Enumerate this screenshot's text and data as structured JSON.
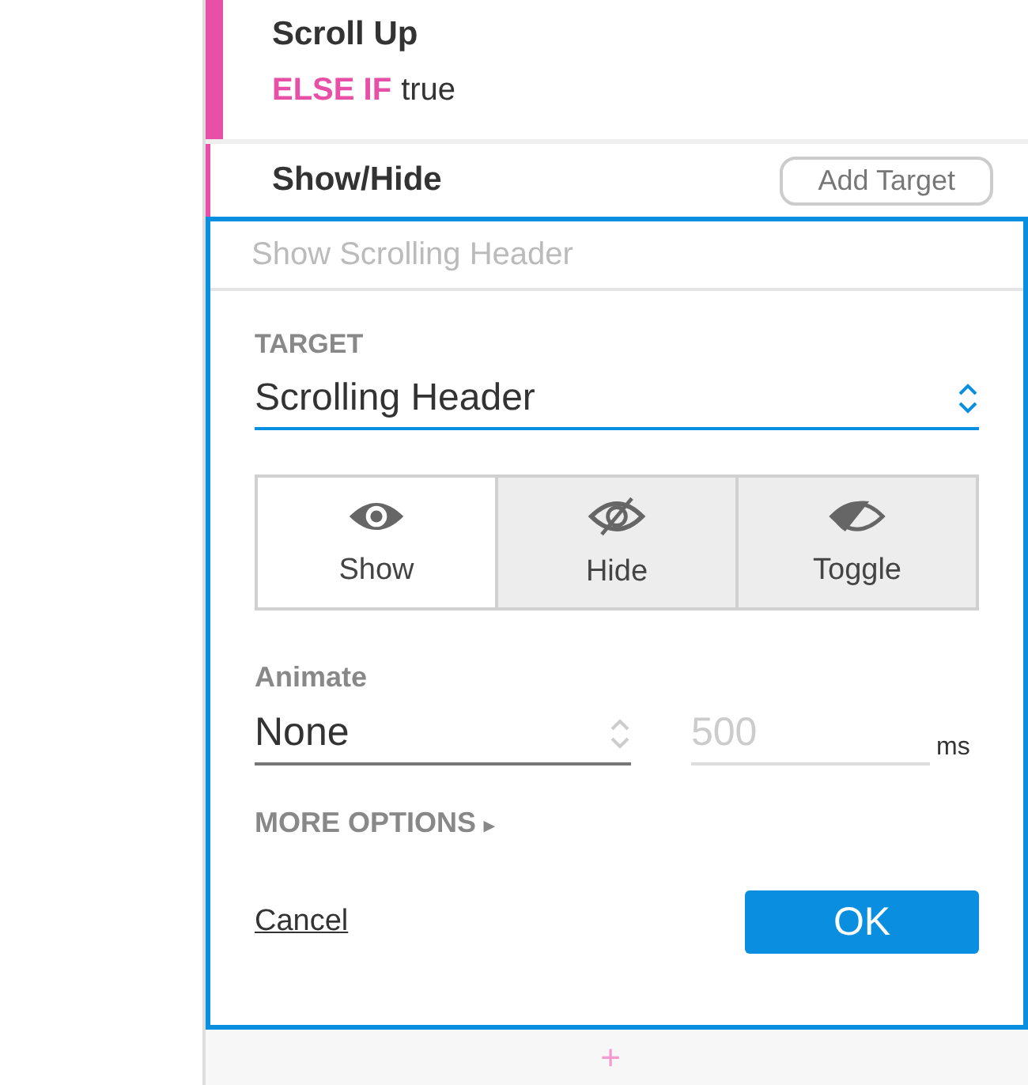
{
  "event": {
    "title": "Scroll Up",
    "condition_keyword": "ELSE IF",
    "condition_value": "true"
  },
  "action": {
    "title": "Show/Hide",
    "add_button": "Add Target"
  },
  "editor": {
    "name_placeholder": "Show Scrolling Header",
    "target_label": "TARGET",
    "target_value": "Scrolling Header",
    "modes": [
      {
        "label": "Show",
        "kind": "show",
        "selected": true
      },
      {
        "label": "Hide",
        "kind": "hide",
        "selected": false
      },
      {
        "label": "Toggle",
        "kind": "toggle",
        "selected": false
      }
    ],
    "animate_label": "Animate",
    "animate_value": "None",
    "duration_placeholder": "500",
    "duration_unit": "ms",
    "more_options": "MORE OPTIONS",
    "more_options_arrow": "▸",
    "cancel": "Cancel",
    "ok": "OK"
  },
  "add_symbol": "+"
}
